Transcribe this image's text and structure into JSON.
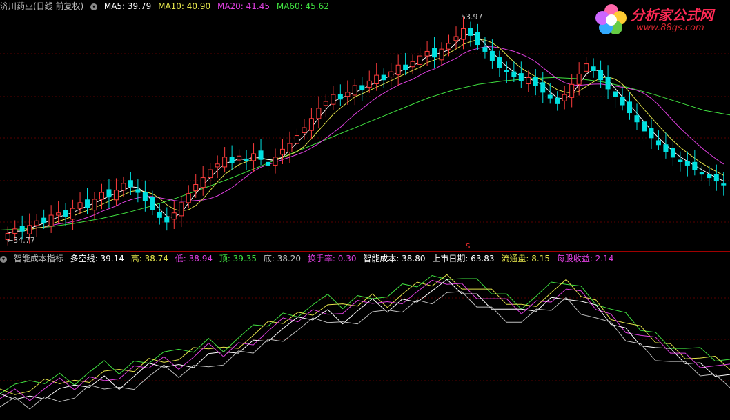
{
  "main_header": {
    "stock_title": "济川药业(日线 前复权)",
    "ma5": {
      "label": "MA5: 39.79",
      "color": "#ffffff"
    },
    "ma10": {
      "label": "MA10: 40.90",
      "color": "#e6e64c"
    },
    "ma20": {
      "label": "MA20: 41.45",
      "color": "#e040e0"
    },
    "ma60": {
      "label": "MA60: 45.62",
      "color": "#40e040"
    }
  },
  "sub_header": {
    "indicator_name": "智能成本指标",
    "duokong": {
      "label": "多空线: 39.14",
      "color": "#ffffff"
    },
    "gao": {
      "label": "高: 38.74",
      "color": "#e6e64c"
    },
    "di": {
      "label": "低: 38.94",
      "color": "#e040e0"
    },
    "ding": {
      "label": "顶: 39.35",
      "color": "#40e040"
    },
    "di2": {
      "label": "底: 38.20",
      "color": "#c0c0c0"
    },
    "huanshoulv": {
      "label": "换手率: 0.30",
      "color": "#e040e0"
    },
    "zhinengchengben": {
      "label": "智能成本: 38.80",
      "color": "#ffffff"
    },
    "shangshiriqi": {
      "label": "上市日期: 63.83",
      "color": "#ffffff"
    },
    "liutongpan": {
      "label": "流通盘: 8.15",
      "color": "#e6e64c"
    },
    "meigushouyi": {
      "label": "每股收益: 2.14",
      "color": "#e040e0"
    }
  },
  "price_marks": {
    "high": "53.97",
    "low": "34.77"
  },
  "sub_marker": "S",
  "logo": {
    "name": "分析家公式网",
    "url": "www.88gs.com"
  },
  "colors": {
    "up": "#ff3c3c",
    "down": "#00e0e0",
    "ma5": "#ffffff",
    "ma10": "#e6e64c",
    "ma20": "#e040e0",
    "ma60": "#40e040",
    "divider": "#a00000"
  },
  "chart_data": {
    "type": "line",
    "candles_close": [
      35.2,
      35.6,
      35.4,
      35.9,
      36.3,
      36.1,
      36.8,
      37.0,
      36.7,
      37.4,
      37.9,
      37.5,
      38.2,
      38.8,
      38.4,
      39.0,
      39.6,
      39.3,
      38.8,
      38.1,
      37.3,
      36.6,
      36.2,
      37.0,
      37.9,
      38.7,
      39.5,
      40.1,
      40.8,
      41.3,
      41.9,
      41.4,
      42.0,
      41.6,
      42.2,
      41.7,
      41.2,
      41.9,
      42.6,
      43.1,
      43.8,
      44.5,
      45.3,
      46.2,
      46.8,
      47.4,
      47.0,
      47.6,
      48.2,
      47.8,
      48.6,
      49.1,
      48.7,
      49.4,
      50.0,
      49.6,
      50.3,
      50.8,
      51.2,
      50.7,
      51.4,
      51.9,
      52.5,
      53.2,
      52.6,
      51.8,
      51.2,
      50.4,
      49.8,
      49.4,
      49.0,
      48.6,
      48.9,
      48.2,
      47.6,
      47.1,
      46.6,
      47.4,
      48.3,
      49.2,
      50.1,
      49.5,
      48.7,
      47.9,
      47.2,
      46.5,
      45.8,
      45.0,
      44.2,
      43.6,
      43.0,
      42.4,
      41.9,
      41.5,
      41.2,
      40.8,
      40.4,
      40.1,
      39.8,
      39.5
    ],
    "ma60_levels": [
      35.5,
      35.6,
      35.8,
      36.1,
      36.5,
      37.0,
      37.6,
      38.3,
      39.1,
      39.9,
      40.8,
      41.7,
      42.6,
      43.5,
      44.4,
      45.3,
      46.2,
      47.1,
      47.8,
      48.3,
      48.6,
      48.8,
      48.9,
      48.8,
      48.5,
      48.0,
      47.4,
      46.7,
      46.0,
      45.6
    ],
    "sub_levels": [
      38.1,
      38.5,
      38.2,
      38.9,
      39.4,
      39.1,
      39.9,
      40.5,
      40.0,
      40.8,
      41.6,
      42.2,
      41.8,
      42.5,
      43.4,
      42.9,
      43.8,
      44.6,
      45.5,
      46.3,
      46.9,
      47.6,
      48.1,
      47.5,
      48.3,
      49.0,
      48.5,
      49.3,
      50.0,
      50.6,
      51.2,
      50.6,
      49.9,
      49.2,
      48.5,
      47.8,
      48.6,
      49.5,
      50.3,
      49.4,
      48.3,
      47.1,
      46.0,
      45.0,
      44.1,
      43.3,
      42.6,
      42.0,
      41.5,
      41.0
    ],
    "ylim": [
      34.5,
      54.5
    ]
  }
}
